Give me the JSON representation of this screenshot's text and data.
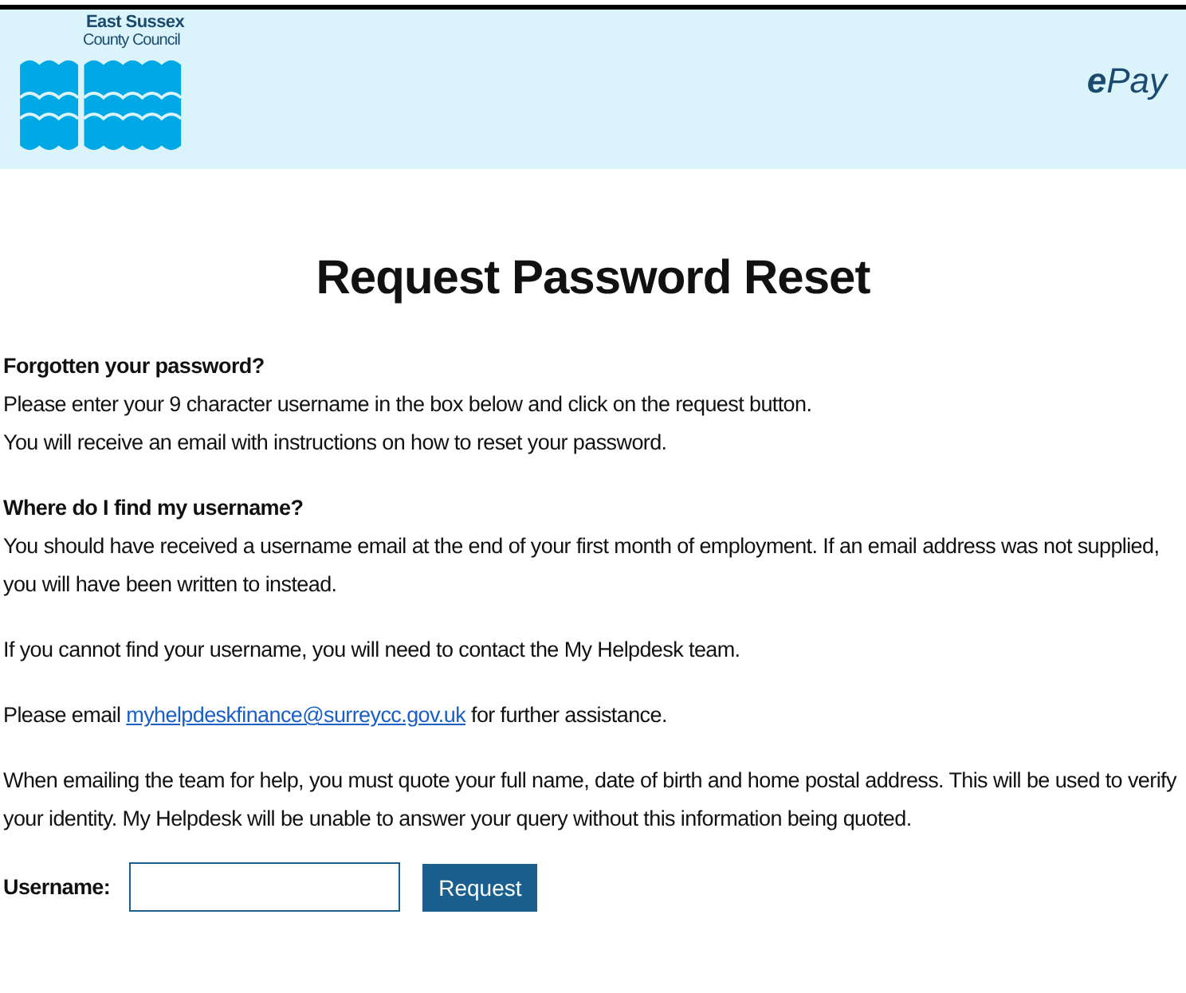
{
  "header": {
    "org_name": "East Sussex",
    "org_sub": "County Council",
    "app_name": "ePay"
  },
  "title": "Request Password Reset",
  "sections": [
    {
      "heading": "Forgotten your password?",
      "lines": [
        "Please enter your 9 character username in the box below and click on the request button.",
        "You will receive an email with instructions on how to reset your password."
      ]
    },
    {
      "heading": "Where do I find my username?",
      "lines": [
        "You should have received a username email at the end of your first month of employment. If an email address was not supplied, you will have been written to instead."
      ]
    }
  ],
  "paragraphs": [
    {
      "text": "If you cannot find your username, you will need to contact the My Helpdesk team."
    },
    {
      "before": "Please email ",
      "link": "myhelpdeskfinance@surreycc.gov.uk",
      "after": " for further assistance."
    },
    {
      "text": "When emailing the team for help, you must quote your full name, date of birth and home postal address. This will be used to verify your identity. My Helpdesk will be unable to answer your query without this information being quoted."
    }
  ],
  "form": {
    "label": "Username:",
    "button": "Request"
  }
}
